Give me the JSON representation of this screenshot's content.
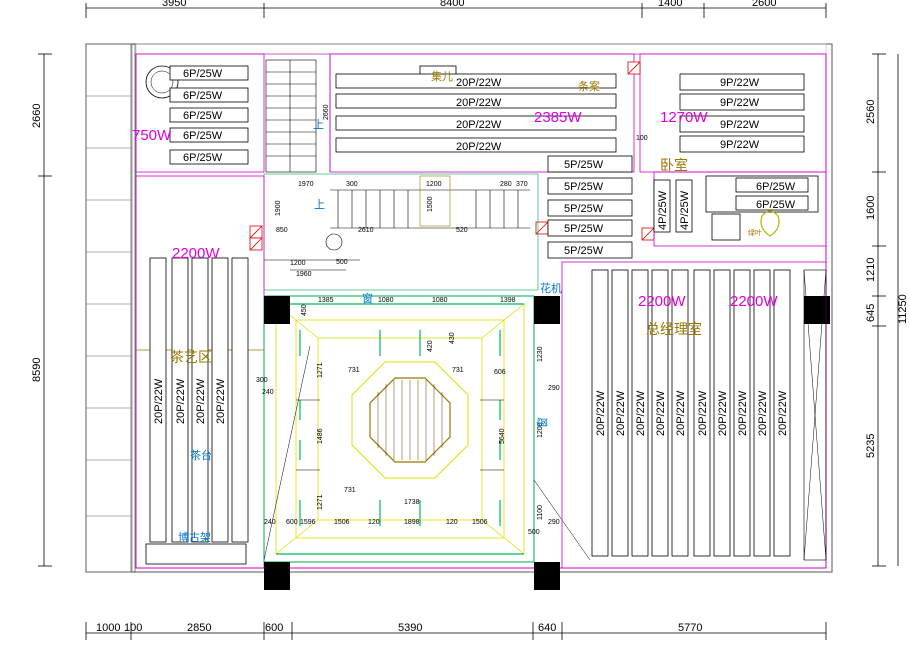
{
  "dims": {
    "top": [
      "3950",
      "8400",
      "1400",
      "2600"
    ],
    "bottom": [
      "1000",
      "100",
      "2850",
      "600",
      "5390",
      "640",
      "5770"
    ],
    "left": [
      "2660",
      "8590"
    ],
    "right": [
      "2560",
      "1600",
      "1210",
      "645",
      "5235"
    ],
    "overall": "11250"
  },
  "fixtures": {
    "p6": "6P/25W",
    "p20_22": "20P/22W",
    "p9": "9P/22W",
    "p5": "5P/25W",
    "p4": "4P/25W",
    "p20_vert": "20P/22W"
  },
  "labels": {
    "w750": "750W",
    "w2385": "2385W",
    "w1270": "1270W",
    "w2200a": "2200W",
    "w2200b": "2200W",
    "w2200c": "2200W",
    "zone_tea": "茶艺区",
    "zone_office": "总经理室",
    "table": "茶台",
    "desk": "条案",
    "meeting": "集儿",
    "up1": "上",
    "up2": "上",
    "fax": "花机",
    "bottom_left": "博古架",
    "plant": "绿叶",
    "window_r": "窗",
    "window_t": "窗",
    "bedroom": "卧室"
  },
  "small": {
    "d1970": "1970",
    "d1200": "1200",
    "d2610": "2610",
    "d850": "850",
    "d1200b": "1200",
    "d1900": "1900",
    "d1960": "1960",
    "d1500": "1500",
    "d2660": "2660",
    "d520": "520",
    "d280": "280",
    "d370": "370",
    "d300": "300",
    "d500": "500",
    "d100": "100",
    "d120": "120",
    "d1080": "1080",
    "d1385": "1385",
    "d1398": "1398",
    "d606": "606",
    "d731": "731",
    "d1271": "1271",
    "d1486": "1486",
    "d5640": "5640",
    "d1738": "1738",
    "d1506": "1506",
    "d1596": "1596",
    "d1898": "1898",
    "d240": "240",
    "d290": "290",
    "d1230": "1230",
    "d1100": "1100",
    "d1200c": "1200",
    "d420": "420",
    "d600": "600",
    "d430": "430",
    "d450": "450"
  }
}
